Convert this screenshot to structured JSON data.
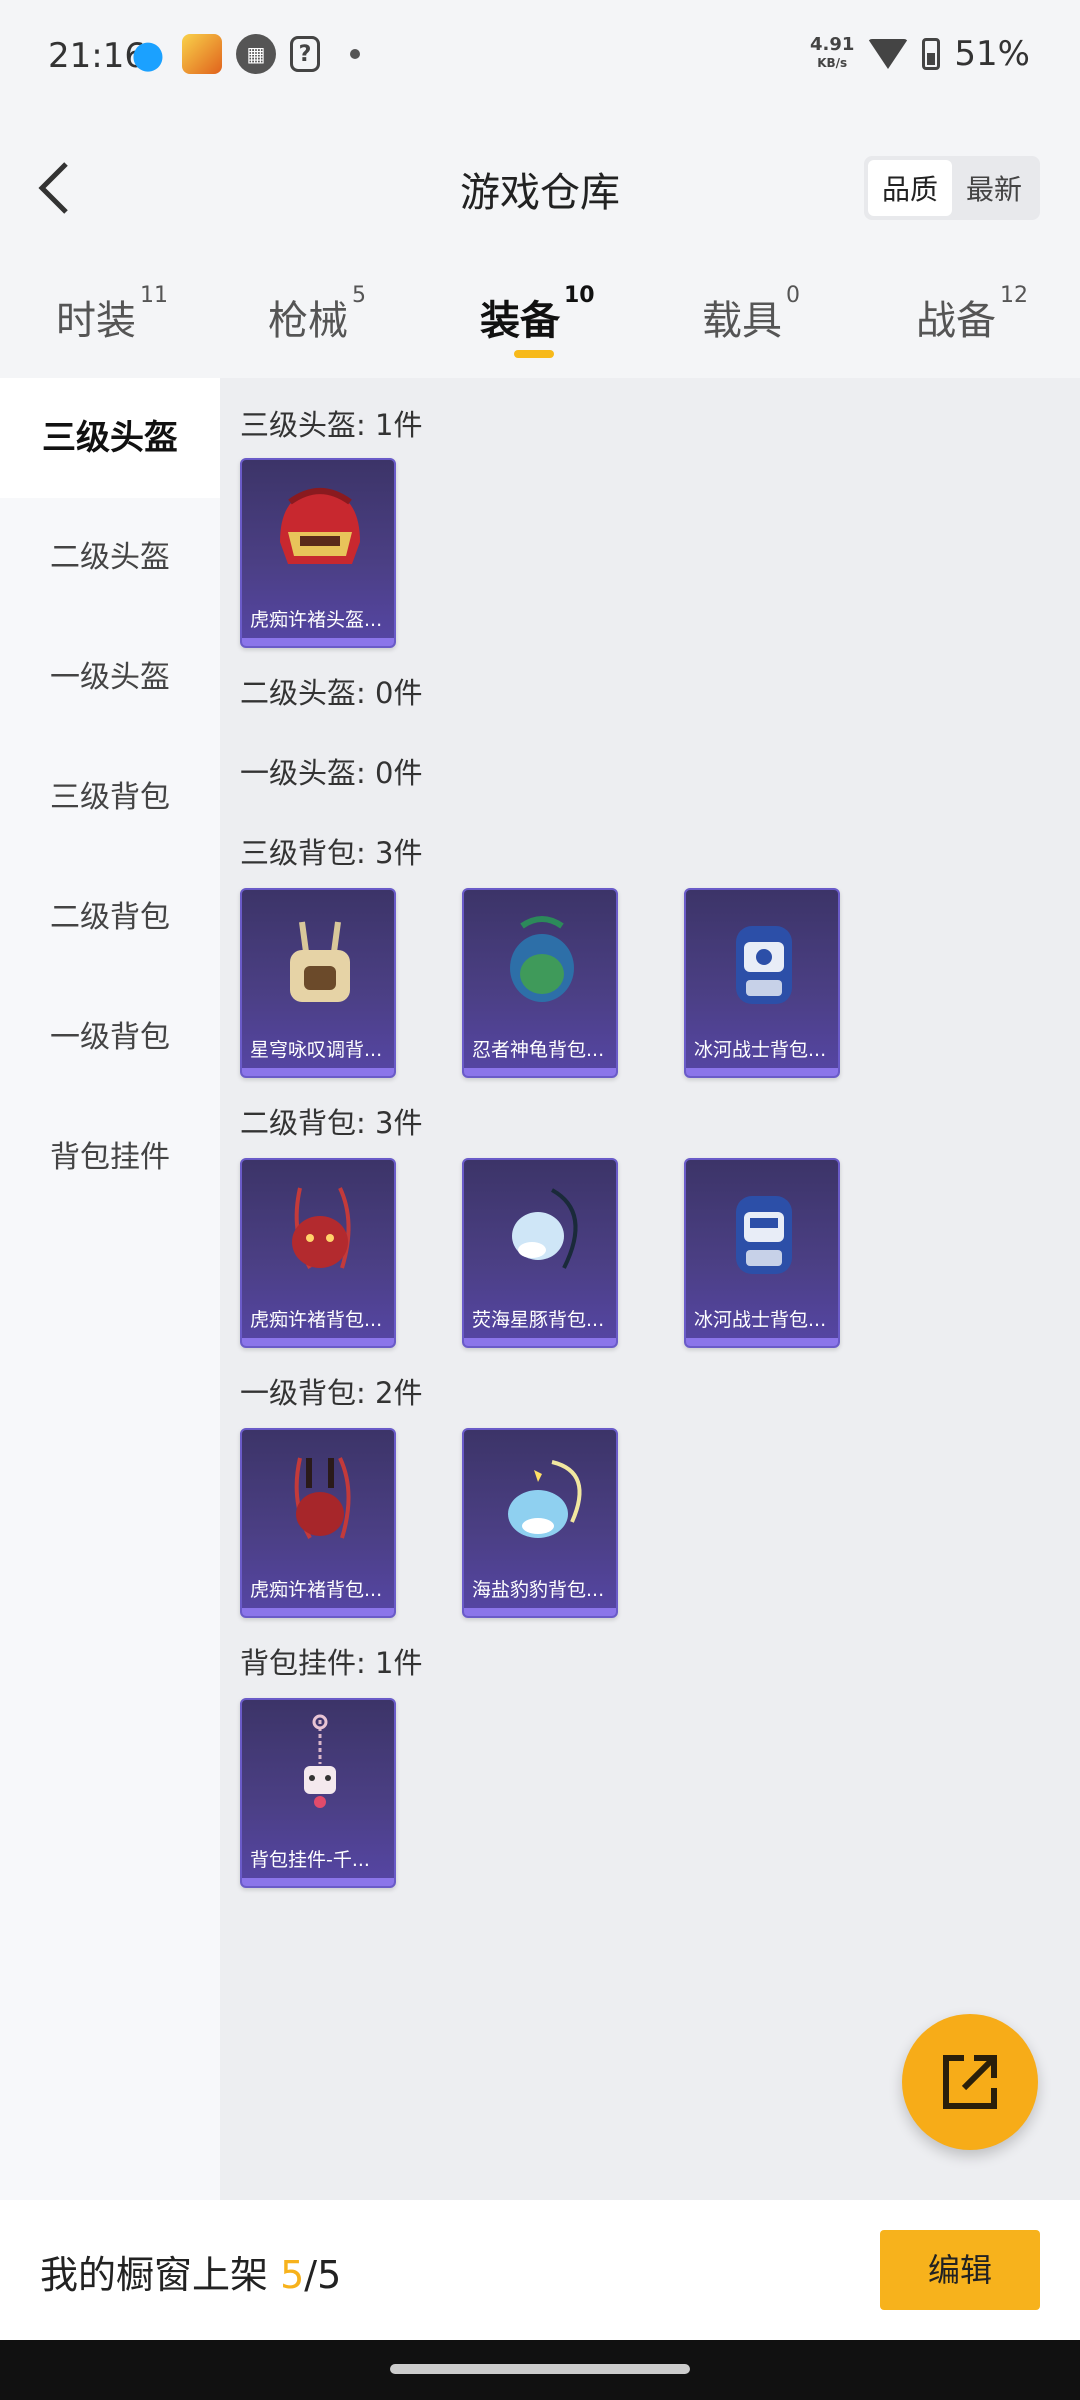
{
  "status_bar": {
    "time": "21:16",
    "net_speed": "4.91",
    "net_unit": "KB/s",
    "battery": "51%"
  },
  "header": {
    "title": "游戏仓库",
    "sort_options": [
      "品质",
      "最新"
    ],
    "active_sort": "品质"
  },
  "tabs": [
    {
      "label": "时装",
      "count": "11"
    },
    {
      "label": "枪械",
      "count": "5"
    },
    {
      "label": "装备",
      "count": "10"
    },
    {
      "label": "载具",
      "count": "0"
    },
    {
      "label": "战备",
      "count": "12"
    }
  ],
  "active_tab": "装备",
  "accent_color": "#f7b21c",
  "sidebar": {
    "items": [
      "三级头盔",
      "二级头盔",
      "一级头盔",
      "三级背包",
      "二级背包",
      "一级背包",
      "背包挂件"
    ],
    "active": "三级头盔"
  },
  "sections": [
    {
      "title": "三级头盔: 1件",
      "items": [
        {
          "label": "虎痴许褚头盔...",
          "icon": "helmet-icon"
        }
      ]
    },
    {
      "title": "二级头盔: 0件",
      "items": []
    },
    {
      "title": "一级头盔: 0件",
      "items": []
    },
    {
      "title": "三级背包: 3件",
      "items": [
        {
          "label": "星穹咏叹调背...",
          "icon": "backpack-icon"
        },
        {
          "label": "忍者神龟背包...",
          "icon": "backpack-icon"
        },
        {
          "label": "冰河战士背包...",
          "icon": "backpack-icon"
        }
      ]
    },
    {
      "title": "二级背包: 3件",
      "items": [
        {
          "label": "虎痴许褚背包...",
          "icon": "backpack-icon"
        },
        {
          "label": "荧海星豚背包...",
          "icon": "backpack-icon"
        },
        {
          "label": "冰河战士背包...",
          "icon": "backpack-icon"
        }
      ]
    },
    {
      "title": "一级背包: 2件",
      "items": [
        {
          "label": "虎痴许褚背包...",
          "icon": "backpack-icon"
        },
        {
          "label": "海盐豹豹背包...",
          "icon": "backpack-icon"
        }
      ]
    },
    {
      "title": "背包挂件: 1件",
      "items": [
        {
          "label": "背包挂件-千...",
          "icon": "charm-icon"
        }
      ]
    }
  ],
  "bottom_bar": {
    "shelf_label": "我的橱窗上架",
    "shelf_current": "5",
    "shelf_total": "/5",
    "edit_label": "编辑"
  }
}
